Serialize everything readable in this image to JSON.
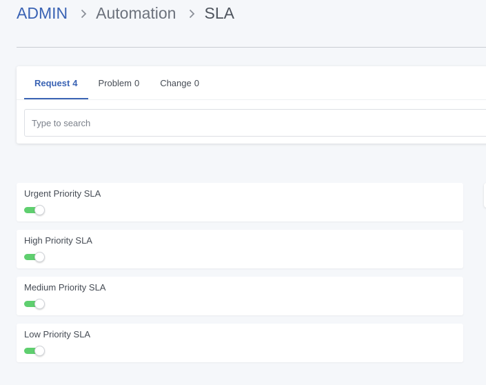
{
  "breadcrumb": {
    "root": "ADMIN",
    "section": "Automation",
    "current": "SLA",
    "separator_icon": "chevron-right-icon"
  },
  "tabs": [
    {
      "label": "Request",
      "count": "4",
      "active": true
    },
    {
      "label": "Problem",
      "count": "0",
      "active": false
    },
    {
      "label": "Change",
      "count": "0",
      "active": false
    }
  ],
  "search": {
    "placeholder": "Type to search",
    "value": ""
  },
  "sla_items": [
    {
      "name": "Urgent Priority SLA",
      "enabled": true
    },
    {
      "name": "High Priority SLA",
      "enabled": true
    },
    {
      "name": "Medium Priority SLA",
      "enabled": true
    },
    {
      "name": "Low Priority SLA",
      "enabled": true
    }
  ],
  "colors": {
    "accent": "#3a63b4",
    "toggle_on": "#5fcf6f",
    "background": "#f5f7fa"
  }
}
